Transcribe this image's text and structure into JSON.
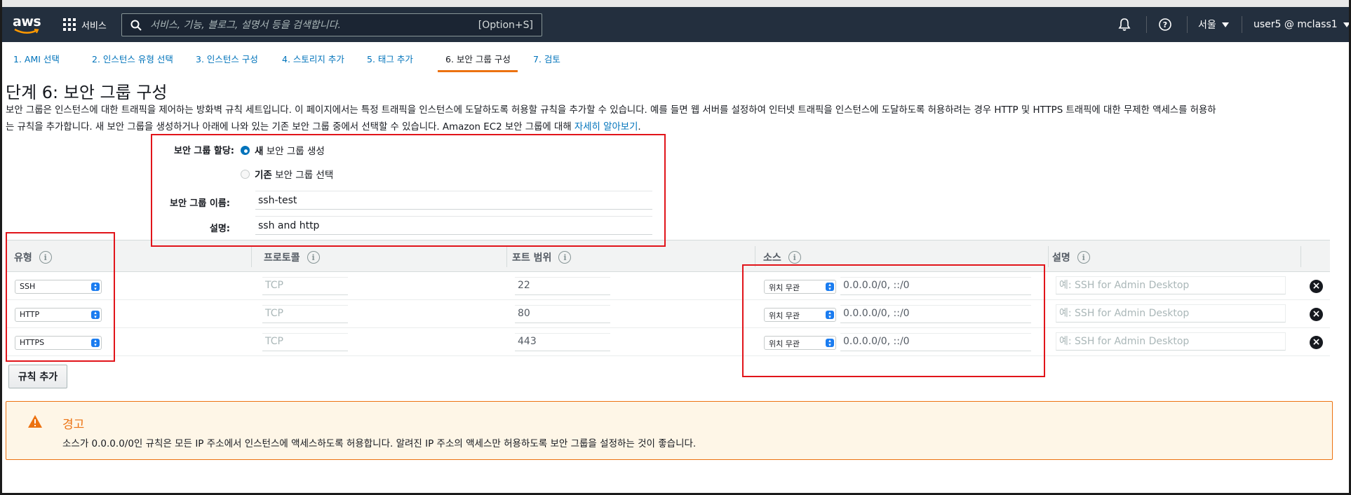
{
  "nav": {
    "services_label": "서비스",
    "search_placeholder": "서비스, 기능, 블로그, 설명서 등을 검색합니다.",
    "search_shortcut": "[Option+S]",
    "region_label": "서울",
    "account_label": "user5 @ mclass1"
  },
  "steps": [
    {
      "label": "1. AMI 선택"
    },
    {
      "label": "2. 인스턴스 유형 선택"
    },
    {
      "label": "3. 인스턴스 구성"
    },
    {
      "label": "4. 스토리지 추가"
    },
    {
      "label": "5. 태그 추가"
    },
    {
      "label": "6. 보안 그룹 구성"
    },
    {
      "label": "7. 검토"
    }
  ],
  "page": {
    "title": "단계 6: 보안 그룹 구성",
    "description_line1": "보안 그룹은 인스턴스에 대한 트래픽을 제어하는 방화벽 규칙 세트입니다. 이 페이지에서는 특정 트래픽을 인스턴스에 도달하도록 허용할 규칙을 추가할 수 있습니다. 예를 들면 웹 서버를 설정하여 인터넷 트래픽을 인스턴스에 도달하도록 허용하려는 경우 HTTP 및 HTTPS 트래픽에 대한 무제한 액세스를 허용하",
    "description_line2": "는 규칙을 추가합니다. 새 보안 그룹을 생성하거나 아래에 나와 있는 기존 보안 그룹 중에서 선택할 수 있습니다. Amazon EC2 보안 그룹에 대해",
    "learn_more_link": "자세히 알아보기",
    "learn_more_tail": "."
  },
  "form": {
    "assign_label": "보안 그룹 할당:",
    "option_new_bold": "새",
    "option_new_rest": "보안 그룹 생성",
    "option_existing_bold": "기존",
    "option_existing_rest": "보안 그룹 선택",
    "name_label": "보안 그룹 이름:",
    "name_value": "ssh-test",
    "desc_label": "설명:",
    "desc_value": "ssh and http"
  },
  "table": {
    "headers": {
      "type": "유형",
      "protocol": "프로토콜",
      "port": "포트 범위",
      "source": "소스",
      "description": "설명"
    },
    "rows": [
      {
        "type": "SSH",
        "protocol": "TCP",
        "port": "22",
        "source_select": "위치 무관",
        "source_cidr": "0.0.0.0/0, ::/0",
        "desc_placeholder": "예: SSH for Admin Desktop"
      },
      {
        "type": "HTTP",
        "protocol": "TCP",
        "port": "80",
        "source_select": "위치 무관",
        "source_cidr": "0.0.0.0/0, ::/0",
        "desc_placeholder": "예: SSH for Admin Desktop"
      },
      {
        "type": "HTTPS",
        "protocol": "TCP",
        "port": "443",
        "source_select": "위치 무관",
        "source_cidr": "0.0.0.0/0, ::/0",
        "desc_placeholder": "예: SSH for Admin Desktop"
      }
    ],
    "add_rule_label": "규칙 추가"
  },
  "warning": {
    "title": "경고",
    "text": "소스가 0.0.0.0/0인 규칙은 모든 IP 주소에서 인스턴스에 액세스하도록 허용합니다. 알려진 IP 주소의 액세스만 허용하도록 보안 그룹을 설정하는 것이 좋습니다."
  },
  "colors": {
    "nav_bg": "#232f3e",
    "link": "#0073bb",
    "accent_orange": "#ec7211",
    "annotation_red": "#e1141a"
  }
}
